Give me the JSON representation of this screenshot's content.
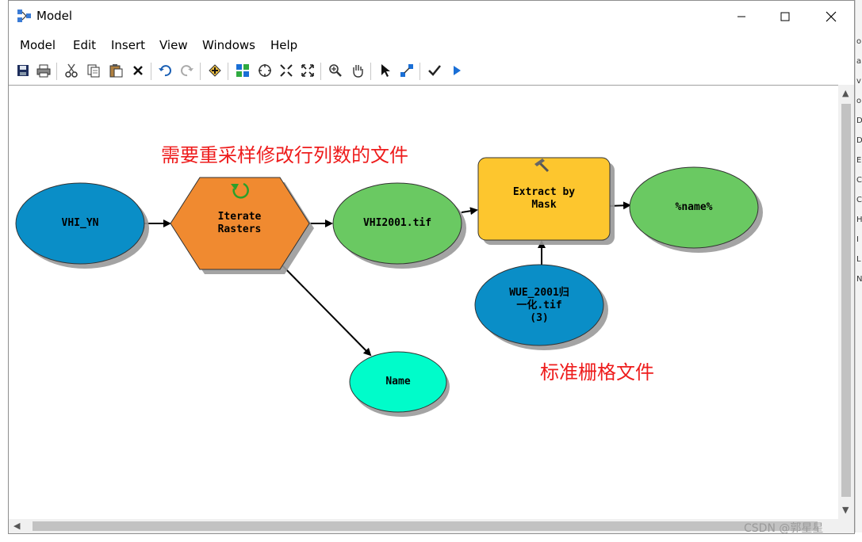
{
  "window": {
    "title": "Model"
  },
  "menu": [
    "Model",
    "Edit",
    "Insert",
    "View",
    "Windows",
    "Help"
  ],
  "toolbar_icons": [
    "save-icon",
    "print-icon",
    "cut-icon",
    "copy-icon",
    "paste-icon",
    "delete-icon",
    "undo-icon",
    "redo-icon",
    "add-data-icon",
    "auto-layout-icon",
    "full-extent-icon",
    "fixed-zoom-in-icon",
    "fixed-zoom-out-icon",
    "zoom-in-icon",
    "pan-icon",
    "select-icon",
    "connect-icon",
    "validate-icon",
    "run-icon"
  ],
  "nodes": {
    "vhi_yn": "VHI_YN",
    "iterate": [
      "Iterate",
      "Rasters"
    ],
    "vhi2001": "VHI2001.tif",
    "extract": [
      "Extract by",
      "Mask"
    ],
    "out": "%name%",
    "wue": [
      "WUE_2001归",
      "一化.tif",
      "(3)"
    ],
    "name": "Name"
  },
  "annotations": {
    "top": "需要重采样修改行列数的文件",
    "bottom": "标准栅格文件"
  },
  "watermark": "CSDN @郭星星",
  "colors": {
    "blue_input": "#0a8ec7",
    "orange_iterator": "#f08a30",
    "green_derived": "#6ac962",
    "yellow_tool": "#fdc62e",
    "cyan_value": "#00fcca",
    "annotation_red": "#ee1c1c"
  },
  "bg_letters": [
    "o",
    "a",
    "v",
    "o",
    "D",
    "D",
    "E",
    "C",
    "C",
    "H",
    "I",
    "L",
    "N"
  ]
}
